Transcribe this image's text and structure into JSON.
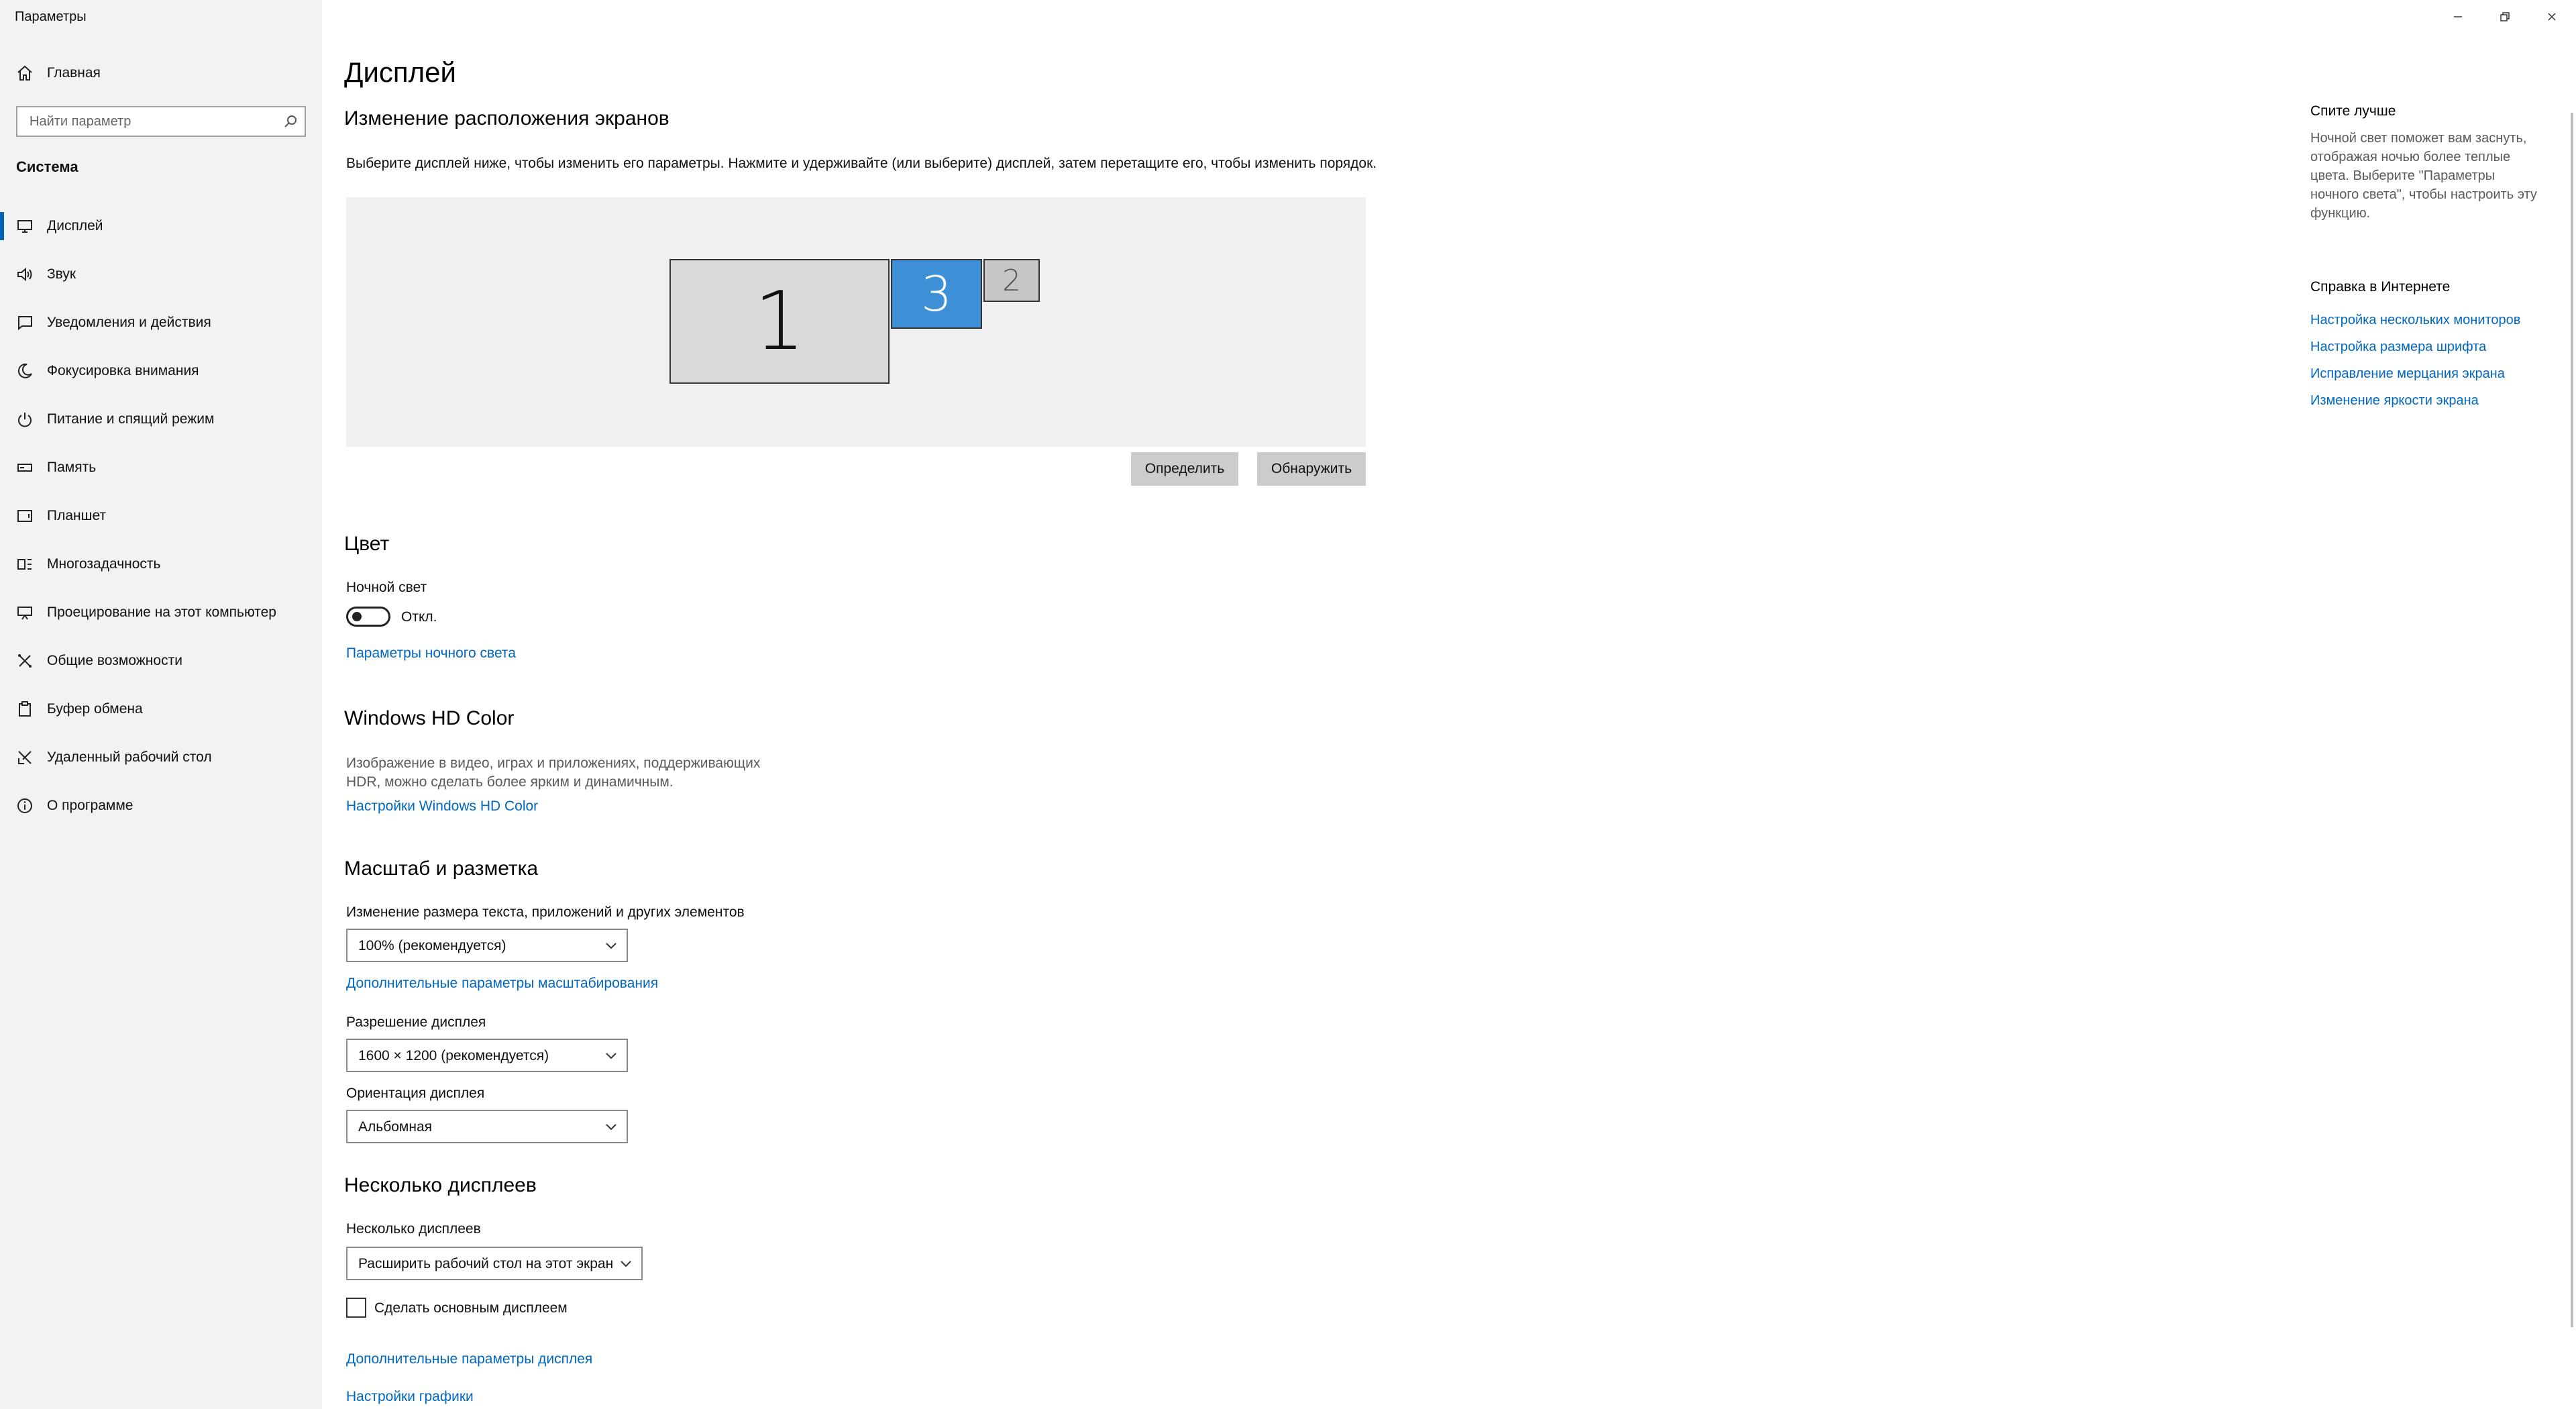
{
  "window": {
    "title": "Параметры"
  },
  "sidebar": {
    "home_label": "Главная",
    "search_placeholder": "Найти параметр",
    "section": "Система",
    "items": [
      {
        "label": "Дисплей",
        "icon": "monitor-icon",
        "active": true
      },
      {
        "label": "Звук",
        "icon": "speaker-icon"
      },
      {
        "label": "Уведомления и действия",
        "icon": "notification-icon"
      },
      {
        "label": "Фокусировка внимания",
        "icon": "moon-icon"
      },
      {
        "label": "Питание и спящий режим",
        "icon": "power-icon"
      },
      {
        "label": "Память",
        "icon": "storage-icon"
      },
      {
        "label": "Планшет",
        "icon": "tablet-icon"
      },
      {
        "label": "Многозадачность",
        "icon": "multitasking-icon"
      },
      {
        "label": "Проецирование на этот компьютер",
        "icon": "projector-icon"
      },
      {
        "label": "Общие возможности",
        "icon": "shared-icon"
      },
      {
        "label": "Буфер обмена",
        "icon": "clipboard-icon"
      },
      {
        "label": "Удаленный рабочий стол",
        "icon": "remote-desktop-icon"
      },
      {
        "label": "О программе",
        "icon": "info-icon"
      }
    ]
  },
  "main": {
    "title": "Дисплей",
    "arrangement": {
      "heading": "Изменение расположения экранов",
      "description": "Выберите дисплей ниже, чтобы изменить его параметры. Нажмите и удерживайте (или выберите) дисплей, затем перетащите его, чтобы изменить порядок.",
      "monitors": [
        "1",
        "3",
        "2"
      ],
      "selected_monitor": "3",
      "identify_label": "Определить",
      "detect_label": "Обнаружить"
    },
    "color": {
      "heading": "Цвет",
      "night_light_label": "Ночной свет",
      "night_light_state": "Откл.",
      "night_light_on": false,
      "night_light_settings_link": "Параметры ночного света"
    },
    "hdr": {
      "heading": "Windows HD Color",
      "description_line1": "Изображение в видео, играх и приложениях, поддерживающих",
      "description_line2": "HDR, можно сделать более ярким и динамичным.",
      "settings_link": "Настройки Windows HD Color"
    },
    "scale": {
      "heading": "Масштаб и разметка",
      "scale_label": "Изменение размера текста, приложений и других элементов",
      "scale_value": "100% (рекомендуется)",
      "advanced_link": "Дополнительные параметры масштабирования",
      "resolution_label": "Разрешение дисплея",
      "resolution_value": "1600 × 1200 (рекомендуется)",
      "orientation_label": "Ориентация дисплея",
      "orientation_value": "Альбомная"
    },
    "multiple": {
      "heading": "Несколько дисплеев",
      "label": "Несколько дисплеев",
      "value": "Расширить рабочий стол на этот экран",
      "make_main_label": "Сделать основным дисплеем",
      "make_main_checked": false,
      "advanced_link": "Дополнительные параметры дисплея",
      "graphics_link": "Настройки графики"
    }
  },
  "right_panel": {
    "sleep_heading": "Спите лучше",
    "sleep_text_lines": [
      "Ночной свет поможет вам заснуть,",
      "отображая ночью более теплые",
      "цвета. Выберите \"Параметры",
      "ночного света\", чтобы настроить эту",
      "функцию."
    ],
    "help_heading": "Справка в Интернете",
    "help_links": [
      "Настройка нескольких мониторов",
      "Настройка размера шрифта",
      "Исправление мерцания экрана",
      "Изменение яркости экрана"
    ]
  },
  "colors": {
    "accent": "#0063b1",
    "link": "#0067c0",
    "selected_monitor": "#3d8fd6"
  }
}
